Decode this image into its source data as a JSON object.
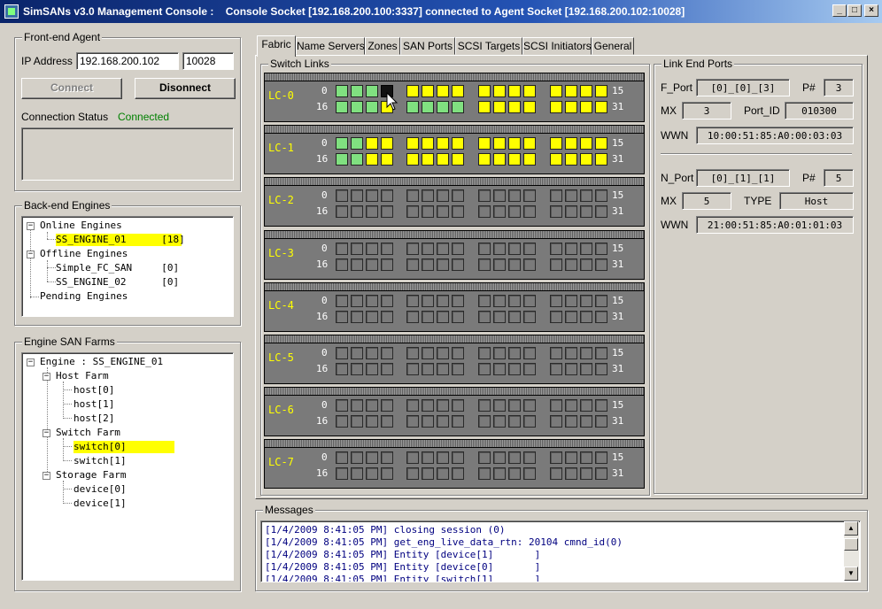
{
  "window": {
    "title": "SimSANs v3.0 Management Console :    Console Socket [192.168.200.100:3337] connected to Agent Socket [192.168.200.102:10028]",
    "min_glyph": "_",
    "max_glyph": "□",
    "close_glyph": "×"
  },
  "frontend": {
    "legend": "Front-end Agent",
    "ip_label": "IP Address",
    "ip_value": "192.168.200.102",
    "port_value": "10028",
    "connect_label": "Connect",
    "disconnect_label": "Disonnect",
    "status_label": "Connection Status",
    "status_value": "Connected",
    "status_color": "#008000"
  },
  "backend": {
    "legend": "Back-end Engines",
    "items": [
      {
        "label": "Online Engines",
        "expander": "−"
      },
      {
        "label": "SS_ENGINE_01      [18]"
      },
      {
        "label": "Offline Engines",
        "expander": "−"
      },
      {
        "label": "Simple_FC_SAN     [0]"
      },
      {
        "label": "SS_ENGINE_02      [0]"
      },
      {
        "label": "Pending Engines"
      }
    ]
  },
  "farms": {
    "legend": "Engine SAN Farms",
    "items": [
      {
        "label": "Engine : SS_ENGINE_01",
        "expander": "−"
      },
      {
        "label": "Host Farm",
        "expander": "−"
      },
      {
        "label": "host[0]"
      },
      {
        "label": "host[1]"
      },
      {
        "label": "host[2]"
      },
      {
        "label": "Switch Farm",
        "expander": "−"
      },
      {
        "label": "switch[0]"
      },
      {
        "label": "switch[1]"
      },
      {
        "label": "Storage Farm",
        "expander": "−"
      },
      {
        "label": "device[0]"
      },
      {
        "label": "device[1]"
      }
    ]
  },
  "tabs": [
    "Fabric",
    "Name Servers",
    "Zones",
    "SAN Ports",
    "SCSI Targets",
    "SCSI Initiators",
    "General"
  ],
  "switch_links": {
    "legend": "Switch Links",
    "cards": [
      {
        "name": "LC-0",
        "lo_start": "0",
        "lo_end": "15",
        "hi_start": "16",
        "hi_end": "31",
        "top": "GGGBYYYYYYYYYYYY",
        "bottom": "GGGYGGGGYYYYYYYY"
      },
      {
        "name": "LC-1",
        "lo_start": "0",
        "lo_end": "15",
        "hi_start": "16",
        "hi_end": "31",
        "top": "GGYYYYYYYYYYYYYY",
        "bottom": "GGYYYYYYYYYYYYYY"
      },
      {
        "name": "LC-2",
        "lo_start": "0",
        "lo_end": "15",
        "hi_start": "16",
        "hi_end": "31",
        "top": "EEEEEEEEEEEEEEEE",
        "bottom": "EEEEEEEEEEEEEEEE"
      },
      {
        "name": "LC-3",
        "lo_start": "0",
        "lo_end": "15",
        "hi_start": "16",
        "hi_end": "31",
        "top": "EEEEEEEEEEEEEEEE",
        "bottom": "EEEEEEEEEEEEEEEE"
      },
      {
        "name": "LC-4",
        "lo_start": "0",
        "lo_end": "15",
        "hi_start": "16",
        "hi_end": "31",
        "top": "EEEEEEEEEEEEEEEE",
        "bottom": "EEEEEEEEEEEEEEEE"
      },
      {
        "name": "LC-5",
        "lo_start": "0",
        "lo_end": "15",
        "hi_start": "16",
        "hi_end": "31",
        "top": "EEEEEEEEEEEEEEEE",
        "bottom": "EEEEEEEEEEEEEEEE"
      },
      {
        "name": "LC-6",
        "lo_start": "0",
        "lo_end": "15",
        "hi_start": "16",
        "hi_end": "31",
        "top": "EEEEEEEEEEEEEEEE",
        "bottom": "EEEEEEEEEEEEEEEE"
      },
      {
        "name": "LC-7",
        "lo_start": "0",
        "lo_end": "15",
        "hi_start": "16",
        "hi_end": "31",
        "top": "EEEEEEEEEEEEEEEE",
        "bottom": "EEEEEEEEEEEEEEEE"
      }
    ]
  },
  "link_end_ports": {
    "legend": "Link End Ports",
    "f_port_label": "F_Port",
    "f_port_value": "[0]_[0]_[3]",
    "f_pnum_label": "P#",
    "f_pnum_value": "3",
    "f_mx_label": "MX",
    "f_mx_value": "3",
    "port_id_label": "Port_ID",
    "port_id_value": "010300",
    "f_wwn_label": "WWN",
    "f_wwn_value": "10:00:51:85:A0:00:03:03",
    "n_port_label": "N_Port",
    "n_port_value": "[0]_[1]_[1]",
    "n_pnum_label": "P#",
    "n_pnum_value": "5",
    "n_mx_label": "MX",
    "n_mx_value": "5",
    "type_label": "TYPE",
    "type_value": "Host",
    "n_wwn_label": "WWN",
    "n_wwn_value": "21:00:51:85:A0:01:01:03"
  },
  "messages": {
    "legend": "Messages",
    "lines": [
      "[1/4/2009 8:41:05 PM] closing session (0)",
      "[1/4/2009 8:41:05 PM] get_eng_live_data_rtn: 20104 cmnd_id(0)",
      "[1/4/2009 8:41:05 PM] Entity [device[1]       ]",
      "[1/4/2009 8:41:05 PM] Entity [device[0]       ]",
      "[1/4/2009 8:41:05 PM] Entity [switch[1]       ]"
    ]
  },
  "colors": {
    "port_green": "#80e080",
    "port_yellow": "#ffff00",
    "selection": "#ffff00",
    "card_name": "#ffff00"
  }
}
